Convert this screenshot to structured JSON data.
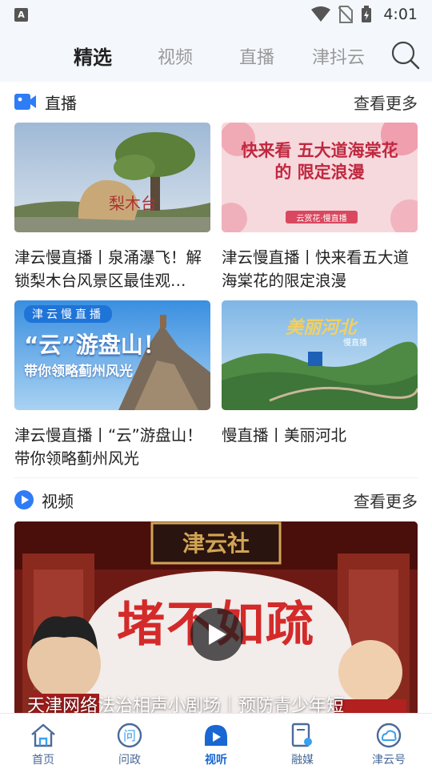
{
  "status_bar": {
    "app_badge": "A",
    "time": "4:01"
  },
  "top_tabs": {
    "items": [
      {
        "label": "精选",
        "active": true
      },
      {
        "label": "视频",
        "active": false
      },
      {
        "label": "直播",
        "active": false
      },
      {
        "label": "津抖云",
        "active": false
      }
    ],
    "search_icon": "search-icon"
  },
  "live_section": {
    "title": "直播",
    "more": "查看更多",
    "icon": "live-camera-icon",
    "cards": [
      {
        "title": "津云慢直播丨泉涌瀑飞！解锁梨木台风景区最佳观…",
        "thumb_text": "梨木台"
      },
      {
        "title": "津云慢直播丨快来看五大道海棠花的限定浪漫",
        "thumb_text": "快来看 五大道海棠花的 限定浪漫",
        "thumb_badge": "云赏花·慢直播"
      },
      {
        "title": "津云慢直播丨“云”游盘山！带你领略蓟州风光",
        "thumb_badge": "津云慢直播",
        "thumb_text": "“云”游盘山！",
        "thumb_sub": "带你领略蓟州风光"
      },
      {
        "title": "慢直播丨美丽河北",
        "thumb_text": "美丽河北",
        "thumb_badge": "慢直播"
      }
    ]
  },
  "video_section": {
    "title": "视频",
    "more": "查看更多",
    "icon": "play-circle-icon",
    "featured": {
      "caption": "天津网络法治相声小剧场｜预防青少年短",
      "sign": "津云社",
      "banner": "堵不如疏"
    }
  },
  "bottom_nav": {
    "items": [
      {
        "label": "首页",
        "icon": "home-icon",
        "active": false
      },
      {
        "label": "问政",
        "icon": "ask-icon",
        "active": false
      },
      {
        "label": "视听",
        "icon": "tv-icon",
        "active": true
      },
      {
        "label": "融媒",
        "icon": "media-icon",
        "active": false
      },
      {
        "label": "津云号",
        "icon": "cloud-account-icon",
        "active": false
      }
    ]
  },
  "colors": {
    "accent": "#1967d2",
    "live_icon": "#2f7cf6",
    "nav_inactive": "#4a6a9a"
  }
}
